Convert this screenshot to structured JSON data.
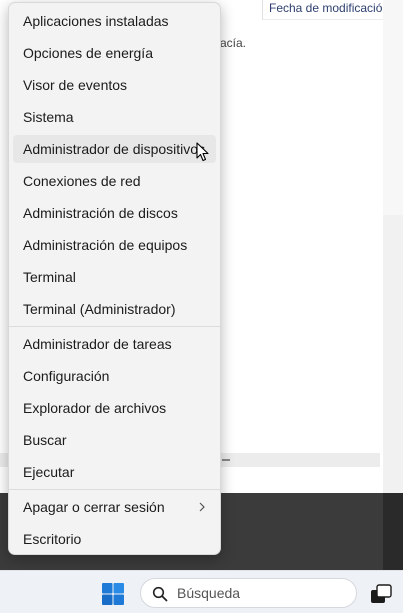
{
  "background_window": {
    "column_header": "Fecha de modificación",
    "empty_text": "acía."
  },
  "menu": {
    "items": [
      {
        "label": "Aplicaciones instaladas"
      },
      {
        "label": "Opciones de energía"
      },
      {
        "label": "Visor de eventos"
      },
      {
        "label": "Sistema"
      },
      {
        "label": "Administrador de dispositivos"
      },
      {
        "label": "Conexiones de red"
      },
      {
        "label": "Administración de discos"
      },
      {
        "label": "Administración de equipos"
      },
      {
        "label": "Terminal"
      },
      {
        "label": "Terminal (Administrador)"
      },
      {
        "label": "Administrador de tareas"
      },
      {
        "label": "Configuración"
      },
      {
        "label": "Explorador de archivos"
      },
      {
        "label": "Buscar"
      },
      {
        "label": "Ejecutar"
      },
      {
        "label": "Apagar o cerrar sesión",
        "submenu": true
      },
      {
        "label": "Escritorio"
      }
    ],
    "hovered_item": "Administrador de dispositivos"
  },
  "taskbar": {
    "search_placeholder": "Búsqueda",
    "icons": [
      "windows-start-icon",
      "search-icon",
      "task-view-icon"
    ]
  },
  "colors": {
    "start_blue": "#1e7ad6",
    "menu_bg": "#f3f3f3",
    "hover_bg": "#e7e7e7"
  }
}
